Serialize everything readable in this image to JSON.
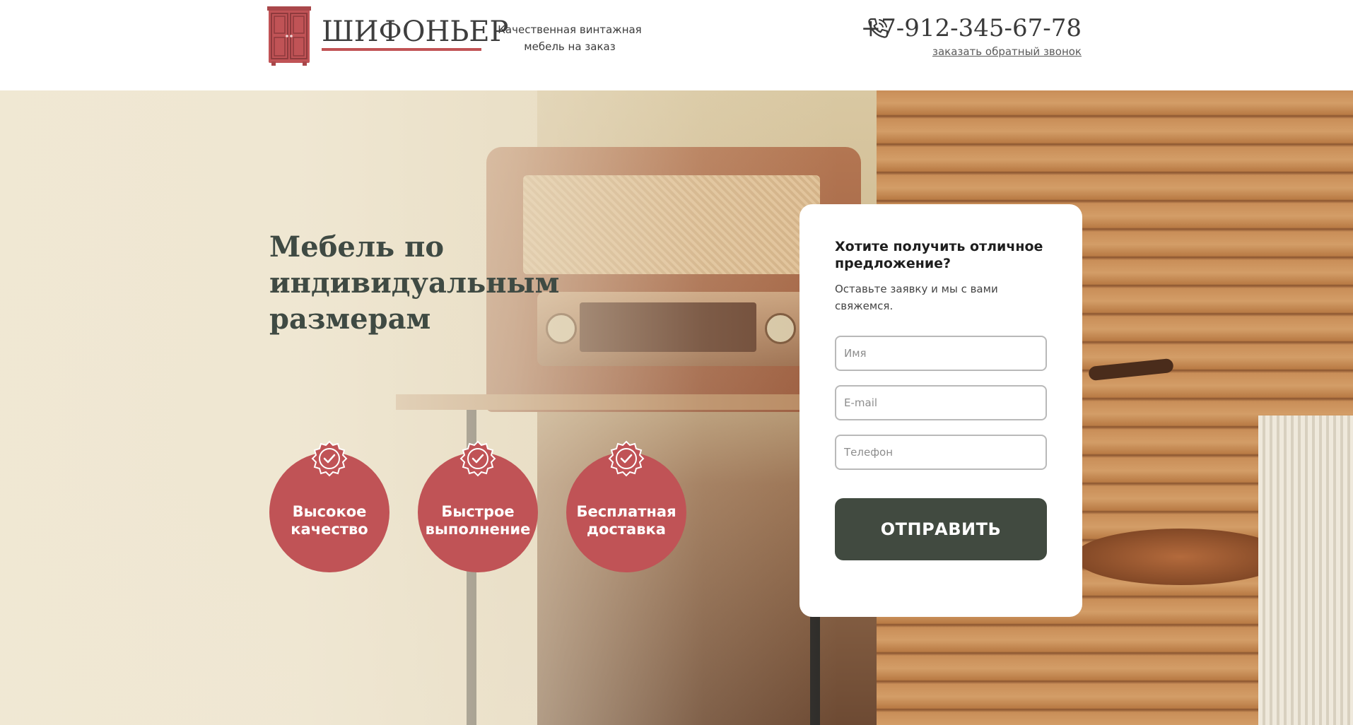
{
  "header": {
    "logo_text": "ШИФОНЬЕР",
    "tagline": "Качественная винтажная мебель на заказ",
    "phone": "+7-912-345-67-78",
    "callback_link": "заказать обратный звонок"
  },
  "hero": {
    "title": "Мебель по индивидуальным размерам",
    "features": [
      {
        "label": "Высокое качество"
      },
      {
        "label": "Быстрое выполнение"
      },
      {
        "label": "Бесплатная доставка"
      }
    ]
  },
  "form": {
    "title": "Хотите получить отличное предложение?",
    "subtitle": "Оставьте заявку и мы с вами свяжемся.",
    "name_placeholder": "Имя",
    "email_placeholder": "E-mail",
    "phone_placeholder": "Телефон",
    "submit_label": "ОТПРАВИТЬ"
  },
  "colors": {
    "accent": "#c05356",
    "button": "#414a40",
    "title_text": "#3f4a43"
  },
  "icons": {
    "logo": "wardrobe-icon",
    "phone": "phone-icon",
    "feature_badge": "check-badge-icon"
  }
}
